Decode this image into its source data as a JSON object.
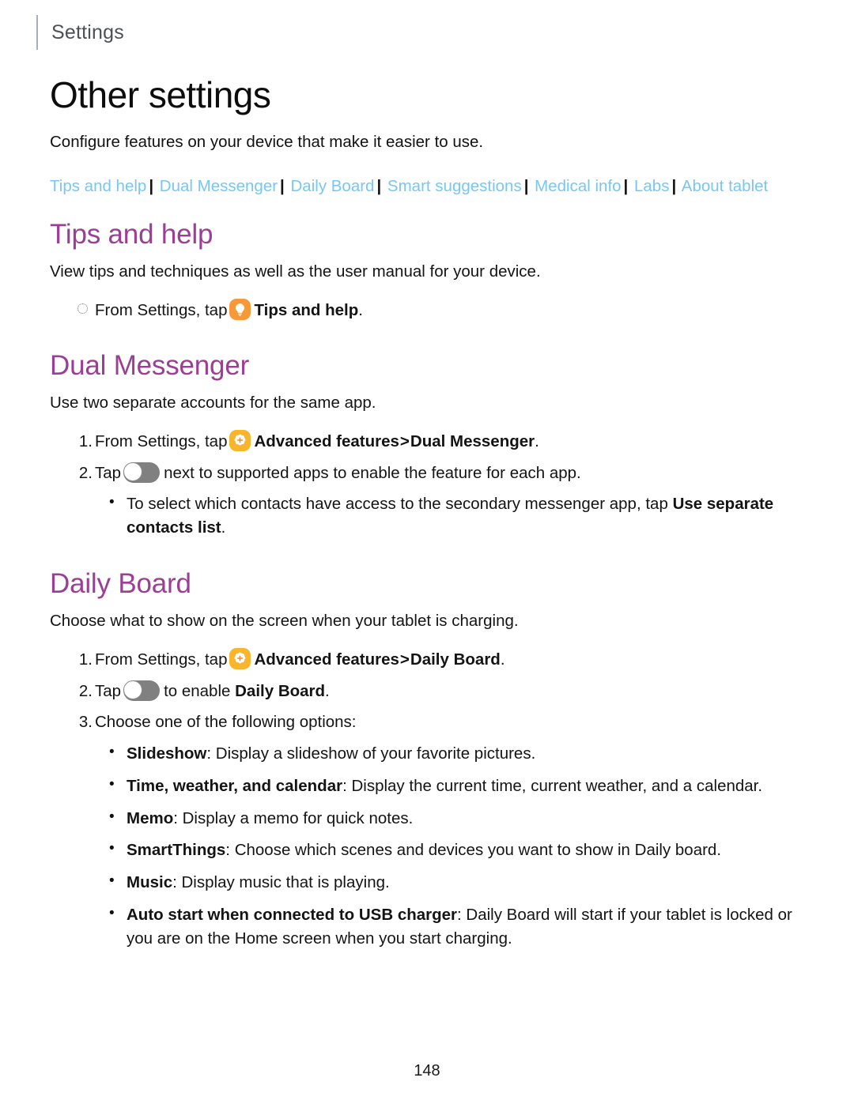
{
  "header": {
    "running_title": "Settings"
  },
  "title": "Other settings",
  "intro": "Configure features on your device that make it easier to use.",
  "nav_links": [
    "Tips and help",
    "Dual Messenger",
    "Daily Board",
    "Smart suggestions",
    "Medical info",
    "Labs",
    "About tablet"
  ],
  "nav_separator": "|",
  "sections": {
    "tips": {
      "heading": "Tips and help",
      "lead": "View tips and techniques as well as the user manual for your device.",
      "step": {
        "prefix": "From Settings, tap",
        "icon": "tips-and-help-icon",
        "bold": "Tips and help",
        "suffix": "."
      }
    },
    "dual_messenger": {
      "heading": "Dual Messenger",
      "lead": "Use two separate accounts for the same app.",
      "step1": {
        "number": "1.",
        "prefix": "From Settings, tap",
        "icon": "advanced-features-icon",
        "bold1": "Advanced features",
        "chevron": ">",
        "bold2": "Dual Messenger",
        "suffix": "."
      },
      "step2": {
        "number": "2.",
        "prefix": "Tap",
        "icon": "toggle-switch-icon",
        "suffix": "next to supported apps to enable the feature for each app."
      },
      "bullet": {
        "text": "To select which contacts have access to the secondary messenger app, tap",
        "bold": "Use separate contacts list",
        "suffix": "."
      }
    },
    "daily_board": {
      "heading": "Daily Board",
      "lead": "Choose what to show on the screen when your tablet is charging.",
      "step1": {
        "number": "1.",
        "prefix": "From Settings, tap",
        "icon": "advanced-features-icon",
        "bold1": "Advanced features",
        "chevron": ">",
        "bold2": "Daily Board",
        "suffix": "."
      },
      "step2": {
        "number": "2.",
        "prefix": "Tap",
        "icon": "toggle-switch-icon",
        "mid": "to enable",
        "bold": "Daily Board",
        "suffix": "."
      },
      "step3": {
        "number": "3.",
        "text": "Choose one of the following options:"
      },
      "options": [
        {
          "label": "Slideshow",
          "desc": ": Display a slideshow of your favorite pictures."
        },
        {
          "label": "Time, weather, and calendar",
          "desc": ": Display the current time, current weather, and a calendar."
        },
        {
          "label": "Memo",
          "desc": ": Display a memo for quick notes."
        },
        {
          "label": "SmartThings",
          "desc": ": Choose which scenes and devices you want to show in Daily board."
        },
        {
          "label": "Music",
          "desc": ": Display music that is playing."
        },
        {
          "label": "Auto start when connected to USB charger",
          "desc": ": Daily Board will start if your tablet is locked or you are on the Home screen when you start charging."
        }
      ]
    }
  },
  "page_number": "148",
  "colors": {
    "heading_purple": "#9b3f95",
    "link_blue": "#79c6f5",
    "tips_icon_orange": "#f89938",
    "advanced_icon_amber": "#f9b62c",
    "toggle_gray": "#808080",
    "header_gray": "#4b5257"
  }
}
